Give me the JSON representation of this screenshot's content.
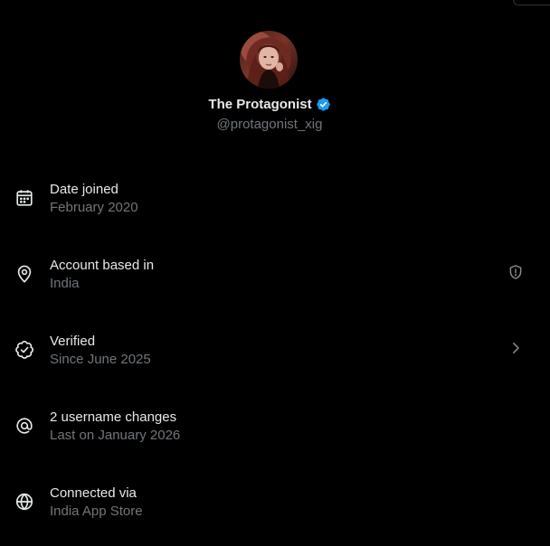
{
  "profile": {
    "display_name": "The Protagonist",
    "handle": "@protagonist_xig",
    "verified": true
  },
  "about_rows": [
    {
      "icon": "calendar-icon",
      "title": "Date joined",
      "subtitle": "February 2020",
      "trailing": null
    },
    {
      "icon": "location-pin-icon",
      "title": "Account based in",
      "subtitle": "India",
      "trailing": "shield-alert-icon"
    },
    {
      "icon": "verified-check-icon",
      "title": "Verified",
      "subtitle": "Since June 2025",
      "trailing": "chevron-right-icon"
    },
    {
      "icon": "at-sign-icon",
      "title": "2 username changes",
      "subtitle": "Last on January 2026",
      "trailing": null
    },
    {
      "icon": "globe-icon",
      "title": "Connected via",
      "subtitle": "India App Store",
      "trailing": null
    }
  ],
  "colors": {
    "background": "#000000",
    "primary_text": "#e7e9ea",
    "secondary_text": "#71767b",
    "verified_blue": "#1d9bf0"
  }
}
